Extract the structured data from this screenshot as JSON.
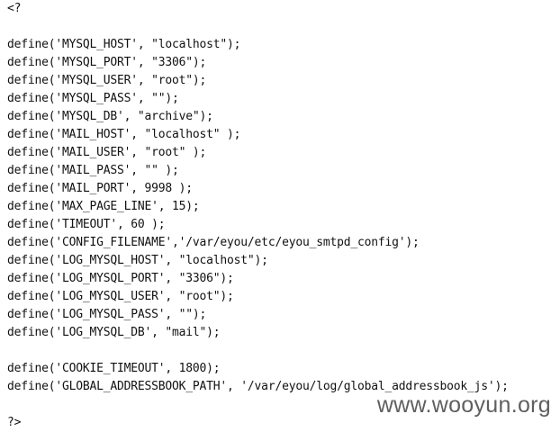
{
  "code": {
    "lines": [
      "<?",
      "",
      "define('MYSQL_HOST', \"localhost\");",
      "define('MYSQL_PORT', \"3306\");",
      "define('MYSQL_USER', \"root\");",
      "define('MYSQL_PASS', \"\");",
      "define('MYSQL_DB', \"archive\");",
      "define('MAIL_HOST', \"localhost\" );",
      "define('MAIL_USER', \"root\" );",
      "define('MAIL_PASS', \"\" );",
      "define('MAIL_PORT', 9998 );",
      "define('MAX_PAGE_LINE', 15);",
      "define('TIMEOUT', 60 );",
      "define('CONFIG_FILENAME','/var/eyou/etc/eyou_smtpd_config');",
      "define('LOG_MYSQL_HOST', \"localhost\");",
      "define('LOG_MYSQL_PORT', \"3306\");",
      "define('LOG_MYSQL_USER', \"root\");",
      "define('LOG_MYSQL_PASS', \"\");",
      "define('LOG_MYSQL_DB', \"mail\");",
      "",
      "define('COOKIE_TIMEOUT', 1800);",
      "define('GLOBAL_ADDRESSBOOK_PATH', '/var/eyou/log/global_addressbook_js');",
      "",
      "?>"
    ]
  },
  "watermark": {
    "text": "www.wooyun.org"
  }
}
